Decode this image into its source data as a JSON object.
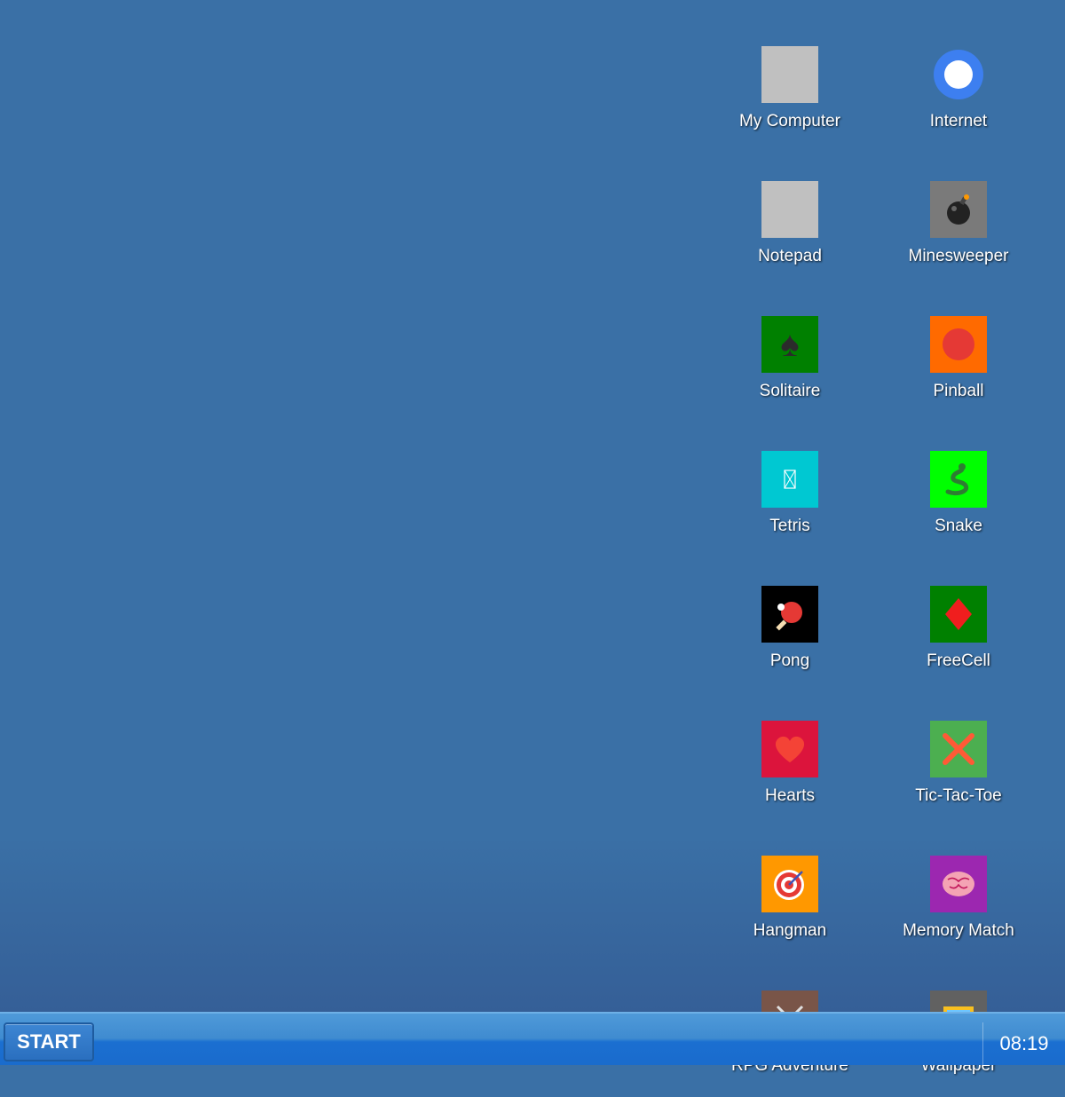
{
  "desktop": {
    "icons": [
      {
        "label": "My Computer",
        "icon": "computer-icon",
        "bg": "#c0c0c0"
      },
      {
        "label": "Internet",
        "icon": "globe-icon",
        "bg": "transparent"
      },
      {
        "label": "Notepad",
        "icon": "notepad-icon",
        "bg": "#c0c0c0"
      },
      {
        "label": "Minesweeper",
        "icon": "bomb-icon",
        "bg": "#7a7a7a"
      },
      {
        "label": "Solitaire",
        "icon": "spade-icon",
        "bg": "#008000"
      },
      {
        "label": "Pinball",
        "icon": "ball-icon",
        "bg": "#ff6a00"
      },
      {
        "label": "Tetris",
        "icon": "tetris-icon",
        "bg": "#00c8d2"
      },
      {
        "label": "Snake",
        "icon": "snake-icon",
        "bg": "#00ff00"
      },
      {
        "label": "Pong",
        "icon": "paddle-icon",
        "bg": "#000000"
      },
      {
        "label": "FreeCell",
        "icon": "diamond-icon",
        "bg": "#008000"
      },
      {
        "label": "Hearts",
        "icon": "heart-icon",
        "bg": "#dc143c"
      },
      {
        "label": "Tic-Tac-Toe",
        "icon": "cross-icon",
        "bg": "#4caf50"
      },
      {
        "label": "Hangman",
        "icon": "target-icon",
        "bg": "#ff9800"
      },
      {
        "label": "Memory Match",
        "icon": "brain-icon",
        "bg": "#9c27b0"
      },
      {
        "label": "RPG Adventure",
        "icon": "swords-icon",
        "bg": "#795548"
      },
      {
        "label": "Wallpaper",
        "icon": "picture-icon",
        "bg": "#616161"
      }
    ]
  },
  "taskbar": {
    "start_label": "START",
    "clock": "08:19"
  }
}
